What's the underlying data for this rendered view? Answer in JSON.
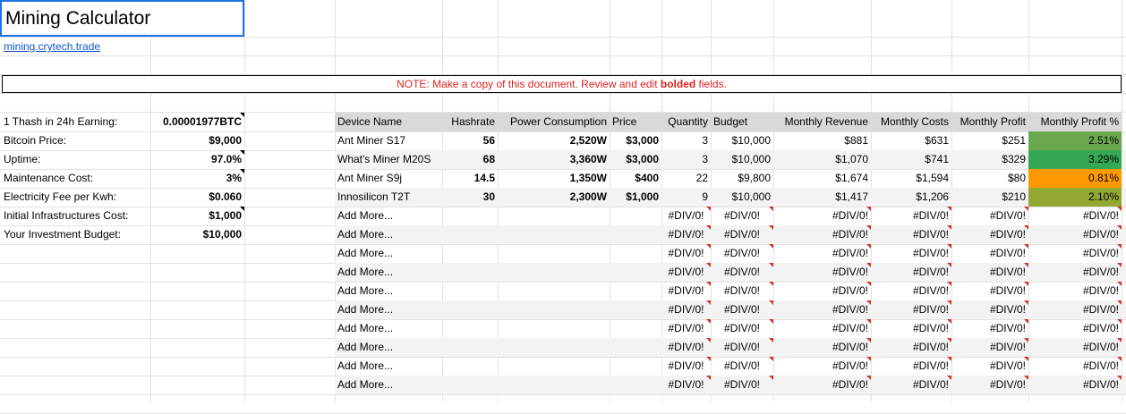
{
  "title": "Mining Calculator",
  "link_text": "mining.crytech.trade",
  "note": {
    "prefix": "NOTE: Make a copy of this document. Review and edit ",
    "bold": "bolded",
    "suffix": " fields."
  },
  "params": [
    {
      "label": "1 Thash in 24h Earning:",
      "value": "0.00001977BTC"
    },
    {
      "label": "Bitcoin Price:",
      "value": "$9,000"
    },
    {
      "label": "Uptime:",
      "value": "97.0%"
    },
    {
      "label": "Maintenance Cost:",
      "value": "3%"
    },
    {
      "label": "Electricity Fee per Kwh:",
      "value": "$0.060"
    },
    {
      "label": "Initial Infrastructures Cost:",
      "value": "$1,000"
    },
    {
      "label": "Your Investment Budget:",
      "value": "$10,000"
    }
  ],
  "table": {
    "headers": [
      "Device Name",
      "Hashrate",
      "Power Consumption",
      "Price",
      "Quantity",
      "Budget",
      "Monthly Revenue",
      "Monthly Costs",
      "Monthly Profit",
      "Monthly Profit %"
    ],
    "rows": [
      [
        "Ant Miner S17",
        "56",
        "2,520W",
        "$3,000",
        "3",
        "$10,000",
        "$881",
        "$631",
        "$251",
        "2.51%"
      ],
      [
        "What's Miner M20S",
        "68",
        "3,360W",
        "$3,000",
        "3",
        "$10,000",
        "$1,070",
        "$741",
        "$329",
        "3.29%"
      ],
      [
        "Ant Miner S9j",
        "14.5",
        "1,350W",
        "$400",
        "22",
        "$9,800",
        "$1,674",
        "$1,594",
        "$80",
        "0.81%"
      ],
      [
        "Innosilicon T2T",
        "30",
        "2,300W",
        "$1,000",
        "9",
        "$10,000",
        "$1,417",
        "$1,206",
        "$210",
        "2.10%"
      ]
    ],
    "profit_pct_colors": [
      "#6aa84f",
      "#34a853",
      "#ff9900",
      "#93a832"
    ],
    "add_more_label": "Add More...",
    "error_value": "#DIV/0!",
    "add_more_count": 10
  }
}
